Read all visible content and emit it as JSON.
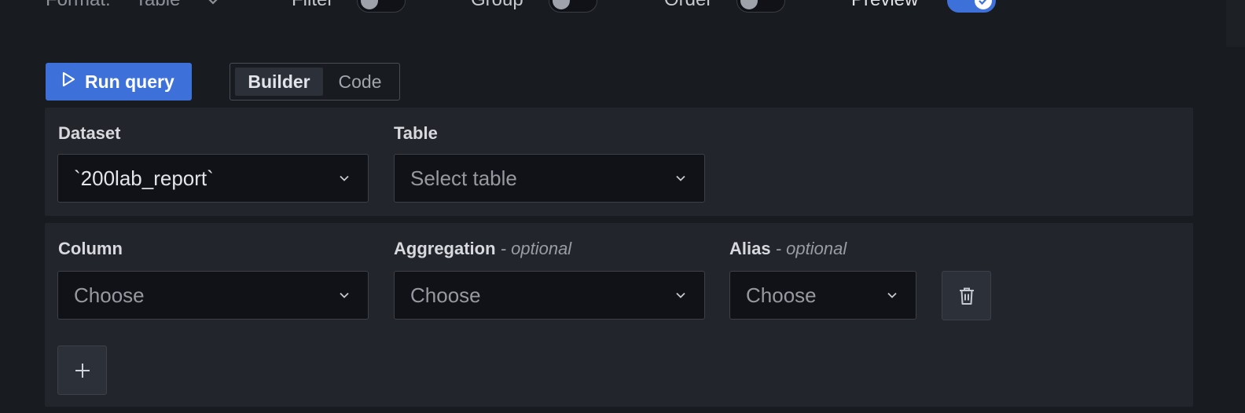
{
  "toolbar": {
    "format_label": "Format:",
    "format_value": "Table",
    "filter_label": "Filter",
    "filter_on": false,
    "group_label": "Group",
    "group_on": false,
    "order_label": "Order",
    "order_on": false,
    "preview_label": "Preview",
    "preview_on": true
  },
  "actions": {
    "run_label": "Run query",
    "mode_tabs": [
      "Builder",
      "Code"
    ],
    "active_mode": "Builder"
  },
  "source": {
    "dataset_label": "Dataset",
    "dataset_value": "`200lab_report`",
    "table_label": "Table",
    "table_placeholder": "Select table"
  },
  "columns": {
    "column_label": "Column",
    "column_placeholder": "Choose",
    "aggregation_label": "Aggregation",
    "aggregation_optional": "- optional",
    "aggregation_placeholder": "Choose",
    "alias_label": "Alias",
    "alias_optional": "- optional",
    "alias_placeholder": "Choose"
  },
  "icons": {
    "run": "play-icon",
    "chevron": "chevron-down-icon",
    "delete": "trash-icon",
    "add": "plus-icon",
    "check": "check-icon"
  },
  "colors": {
    "accent": "#3d71d9",
    "background": "#181b1f",
    "panel": "#22252b"
  }
}
